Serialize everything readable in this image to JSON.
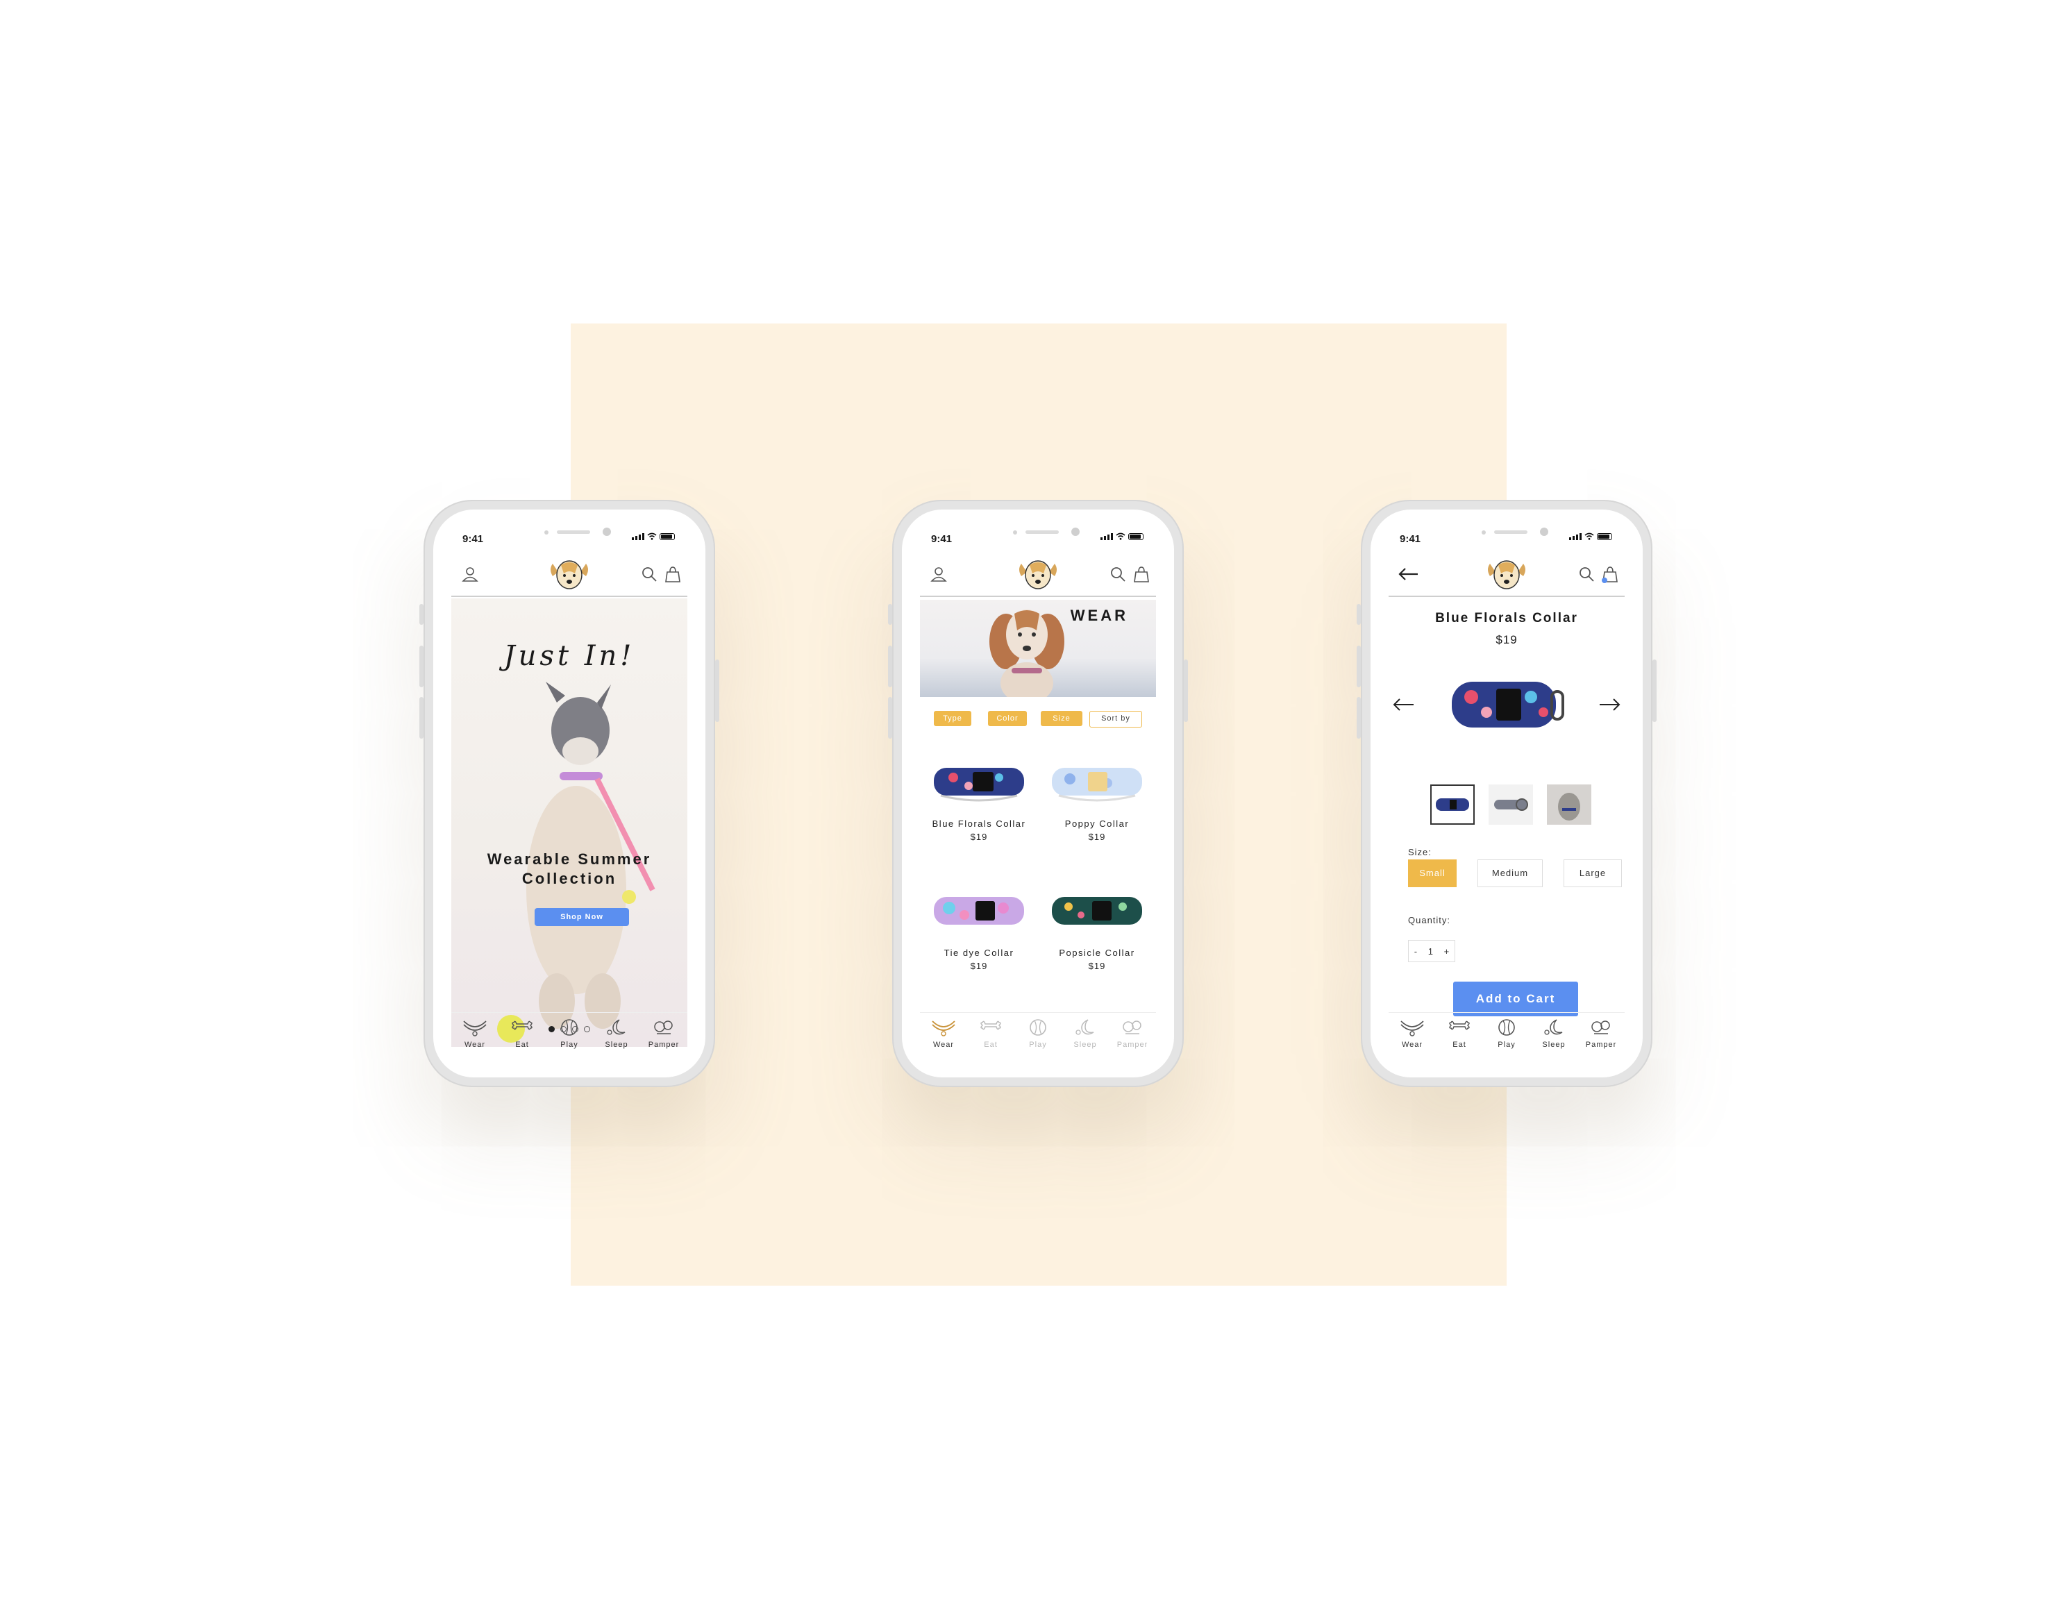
{
  "status_time": "9:41",
  "tabs": [
    "Wear",
    "Eat",
    "Play",
    "Sleep",
    "Pamper"
  ],
  "home": {
    "hero_title": "Just In!",
    "hero_subtitle": "Wearable Summer Collection",
    "cta": "Shop Now",
    "carousel_pages": 4,
    "carousel_active": 1
  },
  "listing": {
    "banner_title": "WEAR",
    "filters": [
      "Type",
      "Color",
      "Size"
    ],
    "sort_label": "Sort by",
    "products": [
      {
        "name": "Blue Florals Collar",
        "price": "$19"
      },
      {
        "name": "Poppy Collar",
        "price": "$19"
      },
      {
        "name": "Tie dye Collar",
        "price": "$19"
      },
      {
        "name": "Popsicle Collar",
        "price": "$19"
      }
    ]
  },
  "detail": {
    "title": "Blue Florals Collar",
    "price": "$19",
    "size_label": "Size:",
    "sizes": [
      "Small",
      "Medium",
      "Large"
    ],
    "selected_size": "Small",
    "quantity_label": "Quantity:",
    "qty_minus": "-",
    "qty_value": "1",
    "qty_plus": "+",
    "add_to_cart": "Add to Cart"
  },
  "colors": {
    "accent_yellow": "#efb94a",
    "accent_blue": "#5b8ff0",
    "backdrop": "#fdf2e0"
  }
}
